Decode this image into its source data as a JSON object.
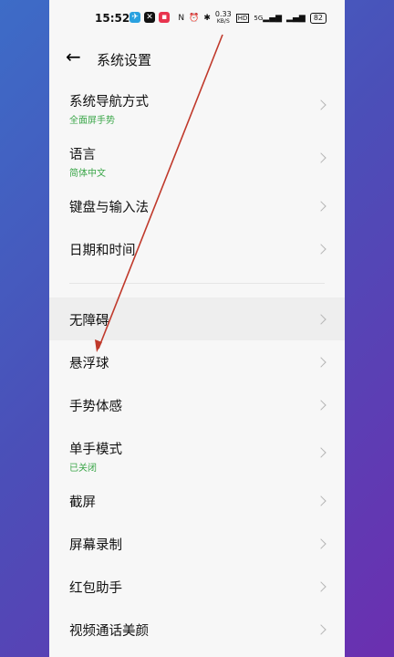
{
  "status": {
    "time": "15:52",
    "speed": "0.33",
    "speed_unit": "KB/S",
    "hd": "HD",
    "network": "5G",
    "battery": "82"
  },
  "header": {
    "title": "系统设置"
  },
  "group1": [
    {
      "label": "系统导航方式",
      "sub": "全面屏手势"
    },
    {
      "label": "语言",
      "sub": "简体中文"
    },
    {
      "label": "键盘与输入法"
    },
    {
      "label": "日期和时间"
    }
  ],
  "group2": [
    {
      "label": "无障碍"
    },
    {
      "label": "悬浮球"
    },
    {
      "label": "手势体感"
    },
    {
      "label": "单手模式",
      "sub": "已关闭"
    },
    {
      "label": "截屏"
    },
    {
      "label": "屏幕录制"
    },
    {
      "label": "红包助手"
    },
    {
      "label": "视频通话美颜"
    }
  ],
  "colors": {
    "accent_green": "#3aa648",
    "annotation_red": "#c0392b"
  }
}
